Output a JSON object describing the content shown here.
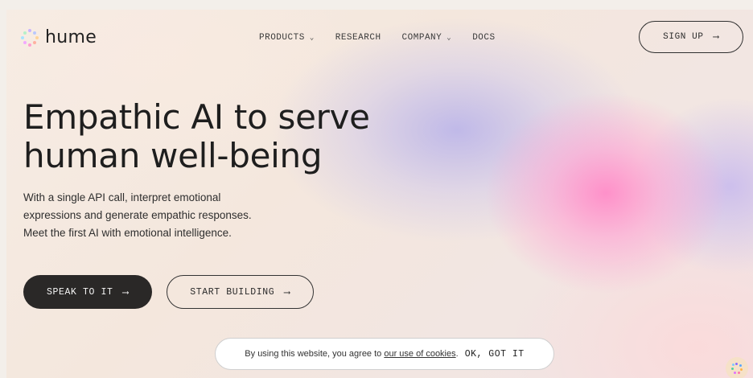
{
  "brand": {
    "name": "hume"
  },
  "nav": {
    "items": [
      {
        "label": "PRODUCTS",
        "has_dropdown": true
      },
      {
        "label": "RESEARCH",
        "has_dropdown": false
      },
      {
        "label": "COMPANY",
        "has_dropdown": true
      },
      {
        "label": "DOCS",
        "has_dropdown": false
      }
    ],
    "signup_label": "SIGN UP",
    "arrow": "⟶"
  },
  "hero": {
    "headline_line1": "Empathic AI to serve",
    "headline_line2": "human well-being",
    "sub_line1": "With a single API call, interpret emotional",
    "sub_line2": "expressions and generate empathic responses.",
    "sub_line3": "Meet the first AI with emotional intelligence.",
    "primary_cta": "SPEAK TO IT",
    "secondary_cta": "START BUILDING"
  },
  "cookie_banner": {
    "text": "By using this website, you agree to",
    "link": "our use of cookies",
    "period": ".",
    "button": "OK, GOT IT"
  },
  "icons": {
    "logo": "dotted-circle-logo-icon",
    "chevron": "chevron-down-icon",
    "arrow": "arrow-right-icon",
    "fab": "dotted-circle-fab-icon"
  },
  "colors": {
    "text_primary": "#1e1e1e",
    "button_dark": "#2a2827",
    "accent_pink": "#ff8cc8",
    "accent_lavender": "#afaaeb",
    "fab_bg": "#f6e1c8"
  }
}
